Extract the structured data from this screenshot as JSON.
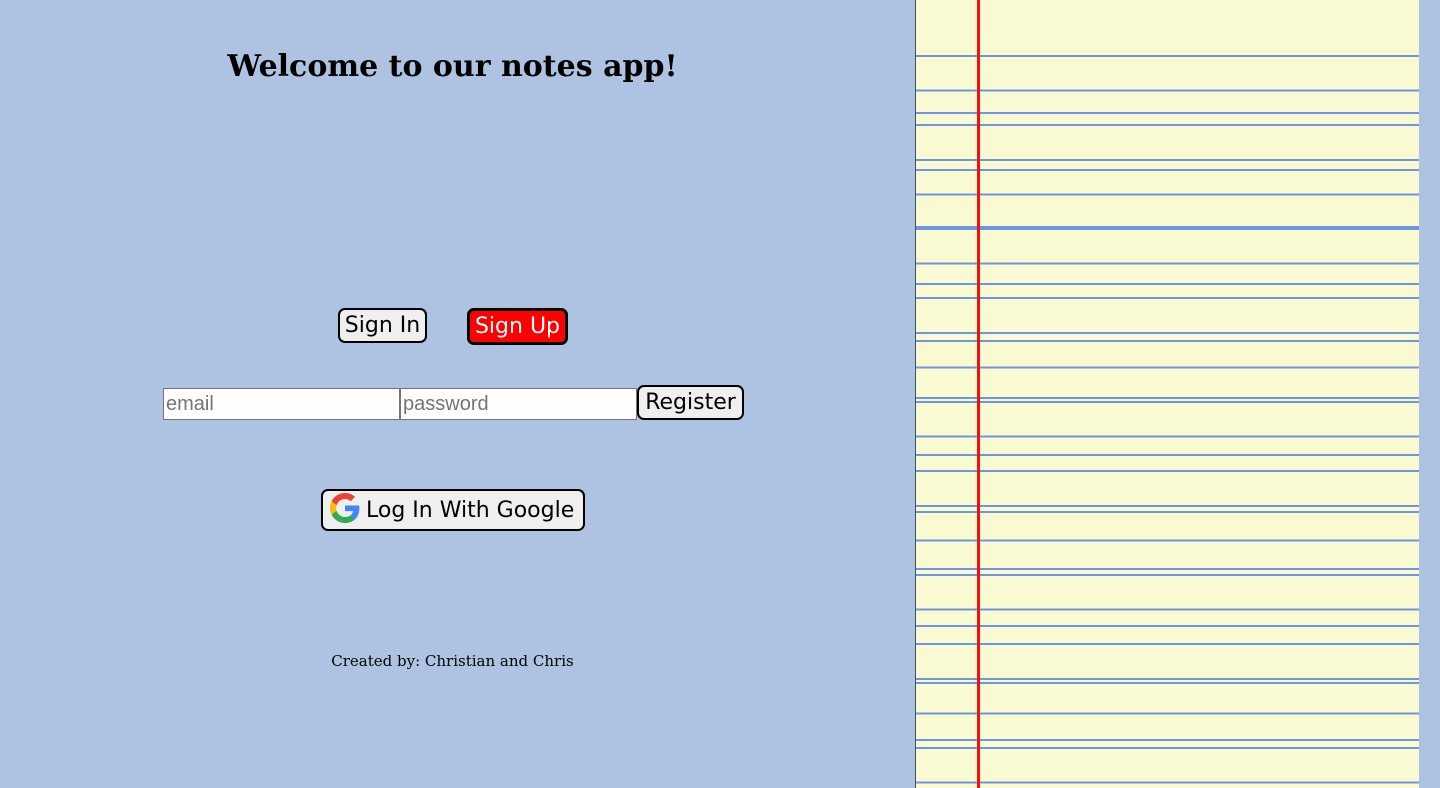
{
  "header": {
    "title": "Welcome to our notes app!"
  },
  "auth_tabs": {
    "sign_in_label": "Sign In",
    "sign_up_label": "Sign Up"
  },
  "form": {
    "email_placeholder": "email",
    "email_value": "",
    "password_placeholder": "password",
    "password_value": "",
    "register_label": "Register"
  },
  "google": {
    "icon": "google-g-icon",
    "label": "Log In With Google"
  },
  "footer": {
    "credits": "Created by: Christian and Chris"
  },
  "colors": {
    "background": "#adc3e1",
    "active_tab": "#ff0000",
    "notepad_paper": "#fafad2",
    "notepad_rule": "#6f95e0",
    "notepad_margin": "#ee1111"
  }
}
